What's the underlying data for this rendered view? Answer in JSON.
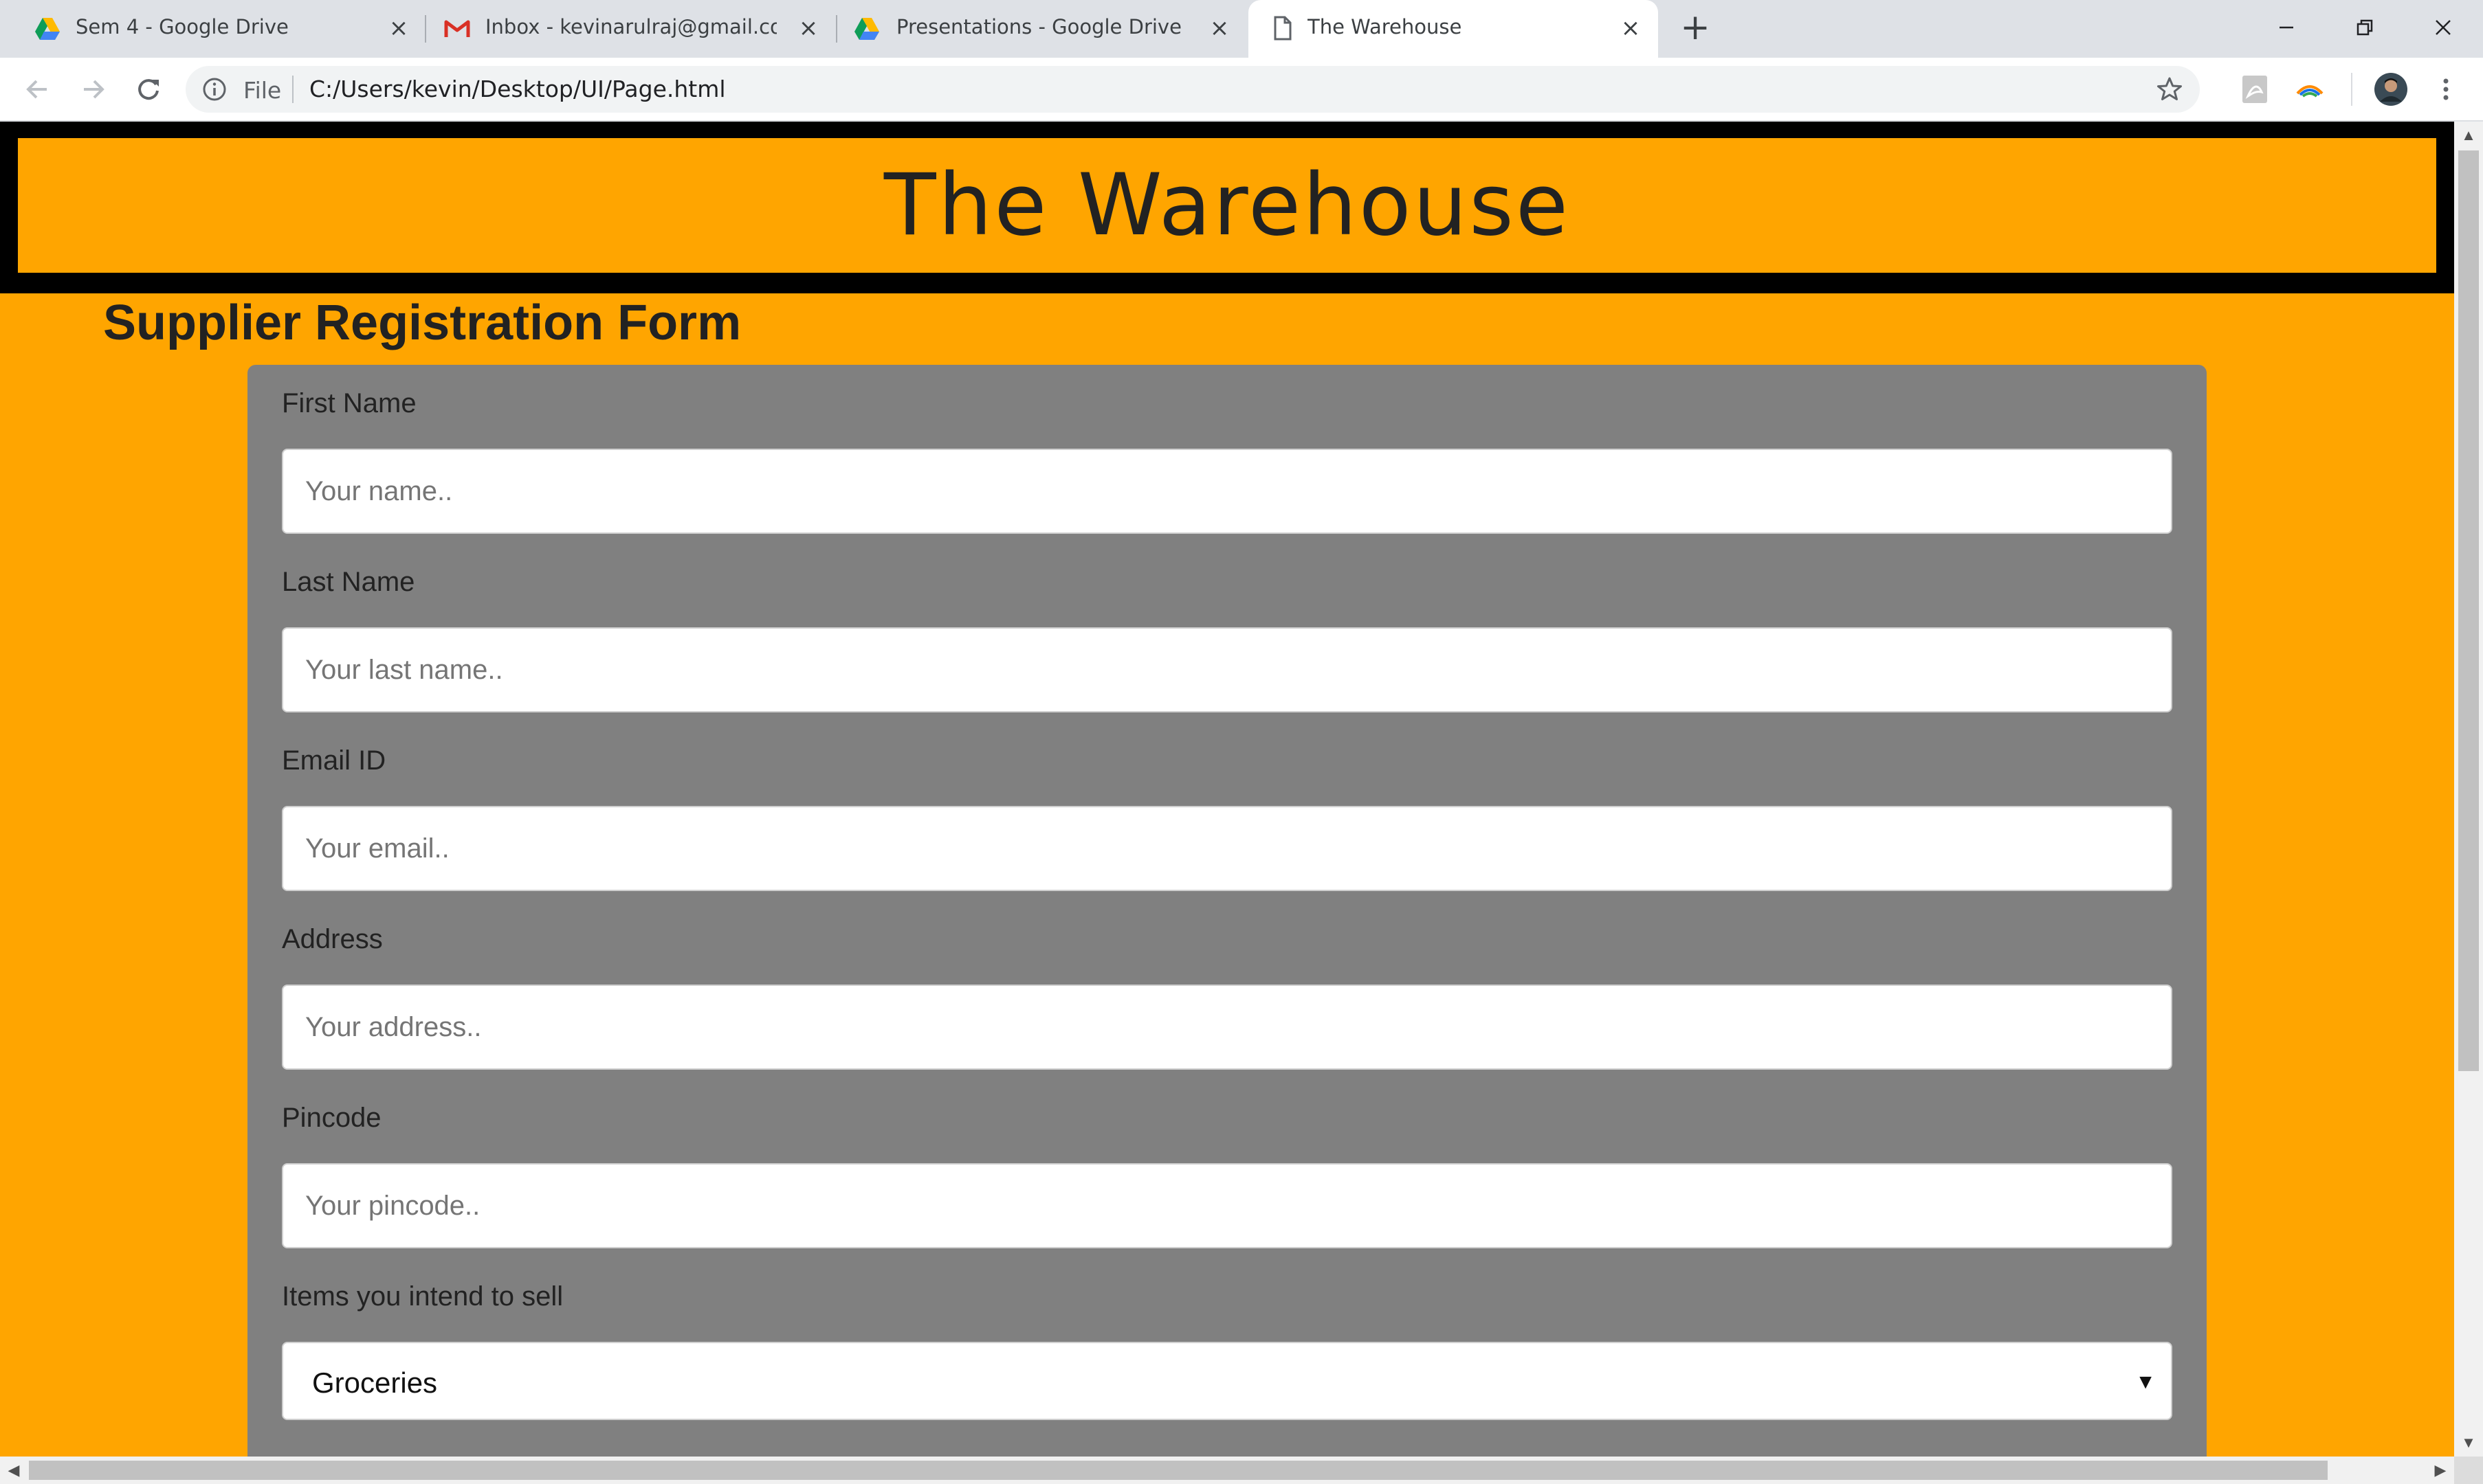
{
  "browser": {
    "tabs": [
      {
        "title": "Sem 4 - Google Drive",
        "icon": "google-drive-icon",
        "active": false
      },
      {
        "title": "Inbox - kevinarulraj@gmail.com",
        "icon": "gmail-icon",
        "active": false
      },
      {
        "title": "Presentations - Google Drive",
        "icon": "google-drive-icon",
        "active": false
      },
      {
        "title": "The Warehouse",
        "icon": "document-icon",
        "active": true
      }
    ],
    "address_bar": {
      "scheme_label": "File",
      "url": "C:/Users/kevin/Desktop/UI/Page.html"
    }
  },
  "page": {
    "header_title": "The Warehouse",
    "form_heading": "Supplier Registration Form",
    "fields": [
      {
        "label": "First Name",
        "placeholder": "Your name.."
      },
      {
        "label": "Last Name",
        "placeholder": "Your last name.."
      },
      {
        "label": "Email ID",
        "placeholder": "Your email.."
      },
      {
        "label": "Address",
        "placeholder": "Your address.."
      },
      {
        "label": "Pincode",
        "placeholder": "Your pincode.."
      }
    ],
    "items_select": {
      "label": "Items you intend to sell",
      "selected": "Groceries"
    }
  },
  "colors": {
    "page_background": "#ffa500",
    "header_border": "#000000",
    "form_card": "#808080",
    "input_background": "#ffffff"
  }
}
